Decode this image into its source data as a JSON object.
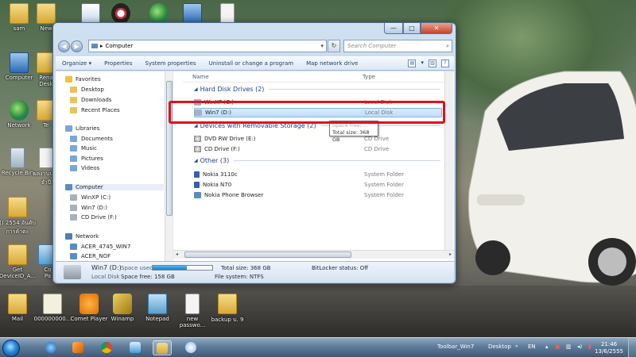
{
  "desktop_icons": [
    {
      "label": "sam",
      "gfx": "folder"
    },
    {
      "label": "New",
      "gfx": "folder"
    },
    {
      "label": "Computer",
      "gfx": "pc"
    },
    {
      "label": "Rena\nDesk",
      "gfx": "folder"
    },
    {
      "label": "Network",
      "gfx": "globe"
    },
    {
      "label": "Te",
      "gfx": "folder"
    },
    {
      "label": "Recycle Bin",
      "gfx": "bin"
    },
    {
      "label": "ผลงานประ\nจำปี",
      "gfx": "doc"
    },
    {
      "label": "() 2554 อันดับ\nการค้าตะ",
      "gfx": "folder"
    },
    {
      "label": "Get\nDeviceID_A...",
      "gfx": "folder"
    },
    {
      "label": "Co\nPa",
      "gfx": "note"
    },
    {
      "label": "Mail",
      "gfx": "folder"
    },
    {
      "label": "000000000...",
      "gfx": "mail"
    },
    {
      "label": "Comet Player",
      "gfx": "orange"
    },
    {
      "label": "Winamp",
      "gfx": "winamp"
    },
    {
      "label": "Notepad",
      "gfx": "note"
    },
    {
      "label": "new\npasswo...",
      "gfx": "doc"
    },
    {
      "label": "backup บ. 9",
      "gfx": "folder"
    }
  ],
  "window": {
    "title_buttons": {
      "minimize": "—",
      "maximize": "□",
      "close": "✕"
    },
    "address": "Computer",
    "search_placeholder": "Search Computer",
    "toolbar": [
      "Organize ▾",
      "Properties",
      "System properties",
      "Uninstall or change a program",
      "Map network drive"
    ],
    "nav": {
      "favorites": "Favorites",
      "favorites_items": [
        "Desktop",
        "Downloads",
        "Recent Places"
      ],
      "libraries": "Libraries",
      "libraries_items": [
        "Documents",
        "Music",
        "Pictures",
        "Videos"
      ],
      "computer": "Computer",
      "computer_items": [
        "WinXP (C:)",
        "Win7 (D:)",
        "CD Drive (F:)"
      ],
      "network": "Network",
      "network_items": [
        "ACER_4745_WIN7",
        "ACER_NOF"
      ]
    },
    "columns": {
      "name": "Name",
      "type": "Type"
    },
    "groups": {
      "hdd": "Hard Disk Drives (2)",
      "removable": "Devices with Removable Storage (2)",
      "other": "Other (3)"
    },
    "hdd_rows": [
      {
        "name": "WinXP (C:)",
        "type": "Local Disk"
      },
      {
        "name": "Win7 (D:)",
        "type": "Local Disk"
      }
    ],
    "removable_rows": [
      {
        "name": "DVD RW Drive (E:)",
        "type": "CD Drive"
      },
      {
        "name": "CD Drive (F:)",
        "type": "CD Drive"
      }
    ],
    "other_rows": [
      {
        "name": "Nokia 3110c",
        "type": "System Folder"
      },
      {
        "name": "Nokia N70",
        "type": "System Folder"
      },
      {
        "name": "Nokia Phone Browser",
        "type": "System Folder"
      }
    ],
    "tooltip": {
      "line1": "Space free: ...",
      "line2": "Total size: 368 GB"
    },
    "details": {
      "drive": "Win7 (D:)",
      "drive_type": "Local Disk",
      "space_used_label": "Space used:",
      "space_used_fraction": 0.57,
      "space_free": "Space free: 158 GB",
      "total_size": "Total size: 368 GB",
      "file_system": "File system: NTFS",
      "bitlocker": "BitLocker status: Off"
    }
  },
  "taskbar": {
    "toolbar_label": "Toolbar_Win7",
    "desktop_label": "Desktop",
    "lang": "EN",
    "time": "21:46",
    "date": "13/6/2555"
  },
  "colors": {
    "selection_highlight": "#e2101a",
    "group_header": "#1e3d8c"
  }
}
